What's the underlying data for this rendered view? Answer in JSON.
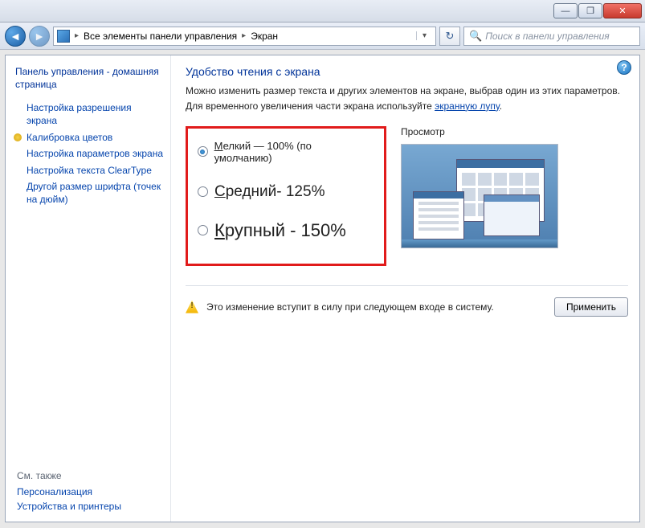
{
  "window": {
    "minimize": "—",
    "maximize": "❐",
    "close": "✕"
  },
  "breadcrumb": {
    "item1": "Все элементы панели управления",
    "item2": "Экран"
  },
  "search": {
    "placeholder": "Поиск в панели управления"
  },
  "sidebar": {
    "home": "Панель управления - домашняя страница",
    "links": [
      "Настройка разрешения экрана",
      "Калибровка цветов",
      "Настройка параметров экрана",
      "Настройка текста ClearType",
      "Другой размер шрифта (точек на дюйм)"
    ],
    "see_also_label": "См. также",
    "see_also": [
      "Персонализация",
      "Устройства и принтеры"
    ]
  },
  "page": {
    "title": "Удобство чтения с экрана",
    "desc1": "Можно изменить размер текста и других элементов на экране, выбрав один из этих параметров.",
    "desc2_a": "Для временного увеличения части экрана используйте ",
    "desc2_link": "экранную лупу",
    "desc2_b": "."
  },
  "options": {
    "small_u": "М",
    "small_rest": "елкий — 100% (по умолчанию)",
    "medium_u": "С",
    "medium_rest": "редний- 125%",
    "large_u": "К",
    "large_rest": "рупный - 150%"
  },
  "preview_label": "Просмотр",
  "notice": "Это изменение вступит в силу при следующем входе в систему.",
  "apply_label": "Применить",
  "help_label": "?"
}
